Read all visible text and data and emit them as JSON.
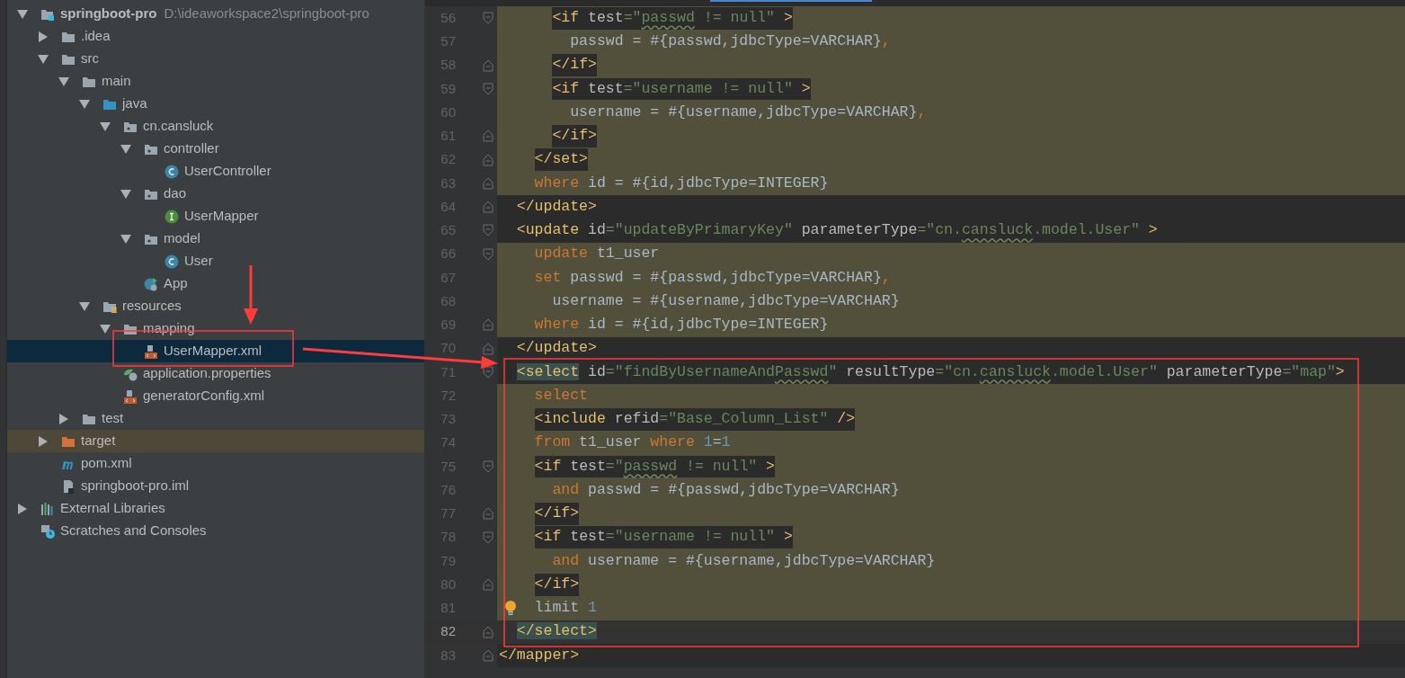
{
  "project_tree": [
    {
      "label": "springboot-pro",
      "path": "D:\\ideaworkspace2\\springboot-pro",
      "kind": "module",
      "expanded": true,
      "selected": false,
      "children": [
        {
          "label": ".idea",
          "kind": "folder",
          "expanded": false,
          "selected": false
        },
        {
          "label": "src",
          "kind": "folder",
          "expanded": true,
          "selected": false,
          "children": [
            {
              "label": "main",
              "kind": "folder",
              "expanded": true,
              "selected": false,
              "children": [
                {
                  "label": "java",
                  "kind": "source-folder",
                  "expanded": true,
                  "selected": false,
                  "children": [
                    {
                      "label": "cn.cansluck",
                      "kind": "package",
                      "expanded": true,
                      "selected": false,
                      "children": [
                        {
                          "label": "controller",
                          "kind": "package",
                          "expanded": true,
                          "selected": false,
                          "children": [
                            {
                              "label": "UserController",
                              "kind": "class",
                              "selected": false
                            }
                          ]
                        },
                        {
                          "label": "dao",
                          "kind": "package",
                          "expanded": true,
                          "selected": false,
                          "children": [
                            {
                              "label": "UserMapper",
                              "kind": "interface",
                              "selected": false
                            }
                          ]
                        },
                        {
                          "label": "model",
                          "kind": "package",
                          "expanded": true,
                          "selected": false,
                          "children": [
                            {
                              "label": "User",
                              "kind": "class",
                              "selected": false
                            }
                          ]
                        },
                        {
                          "label": "App",
                          "kind": "spring-app",
                          "selected": false
                        }
                      ]
                    }
                  ]
                },
                {
                  "label": "resources",
                  "kind": "resources-folder",
                  "expanded": true,
                  "selected": false,
                  "children": [
                    {
                      "label": "mapping",
                      "kind": "folder",
                      "expanded": true,
                      "selected": false,
                      "children": [
                        {
                          "label": "UserMapper.xml",
                          "kind": "xml",
                          "selected": true
                        }
                      ]
                    },
                    {
                      "label": "application.properties",
                      "kind": "spring-properties",
                      "selected": false
                    },
                    {
                      "label": "generatorConfig.xml",
                      "kind": "xml",
                      "selected": false
                    }
                  ]
                }
              ]
            },
            {
              "label": "test",
              "kind": "folder",
              "expanded": false,
              "selected": false
            }
          ]
        },
        {
          "label": "target",
          "kind": "excluded-folder",
          "expanded": false,
          "selected": false
        },
        {
          "label": "pom.xml",
          "kind": "maven",
          "selected": false
        },
        {
          "label": "springboot-pro.iml",
          "kind": "iml",
          "selected": false
        }
      ]
    },
    {
      "label": "External Libraries",
      "kind": "libraries",
      "expanded": false,
      "selected": false
    },
    {
      "label": "Scratches and Consoles",
      "kind": "scratches",
      "selected": false
    }
  ],
  "editor": {
    "lines": [
      {
        "number": "56",
        "highlighted": true,
        "tag_chip": true,
        "fold_start": true,
        "fold_end": false,
        "current": false,
        "tokens": [
          {
            "text": "      <if",
            "kind": "tag"
          },
          {
            "text": " test",
            "kind": "attr"
          },
          {
            "text": "=\"",
            "kind": "string"
          },
          {
            "text": "passwd",
            "kind": "string",
            "typo": true
          },
          {
            "text": " != null\"",
            "kind": "string"
          },
          {
            "text": " >",
            "kind": "tag"
          }
        ]
      },
      {
        "number": "57",
        "highlighted": true,
        "tag_chip": false,
        "fold_start": false,
        "fold_end": false,
        "current": false,
        "tokens": [
          {
            "text": "        passwd = #{passwd,jdbcType=VARCHAR}",
            "kind": "plain"
          },
          {
            "text": ",",
            "kind": "keyword"
          }
        ]
      },
      {
        "number": "58",
        "highlighted": true,
        "tag_chip": true,
        "fold_start": false,
        "fold_end": true,
        "current": false,
        "tokens": [
          {
            "text": "      </if>",
            "kind": "tag"
          }
        ]
      },
      {
        "number": "59",
        "highlighted": true,
        "tag_chip": true,
        "fold_start": true,
        "fold_end": false,
        "current": false,
        "tokens": [
          {
            "text": "      <if",
            "kind": "tag"
          },
          {
            "text": " test",
            "kind": "attr"
          },
          {
            "text": "=\"username != null\"",
            "kind": "string"
          },
          {
            "text": " >",
            "kind": "tag"
          }
        ]
      },
      {
        "number": "60",
        "highlighted": true,
        "tag_chip": false,
        "fold_start": false,
        "fold_end": false,
        "current": false,
        "tokens": [
          {
            "text": "        username = #{username,jdbcType=VARCHAR}",
            "kind": "plain"
          },
          {
            "text": ",",
            "kind": "keyword"
          }
        ]
      },
      {
        "number": "61",
        "highlighted": true,
        "tag_chip": true,
        "fold_start": false,
        "fold_end": true,
        "current": false,
        "tokens": [
          {
            "text": "      </if>",
            "kind": "tag"
          }
        ]
      },
      {
        "number": "62",
        "highlighted": true,
        "tag_chip": true,
        "fold_start": false,
        "fold_end": true,
        "current": false,
        "tokens": [
          {
            "text": "    </set>",
            "kind": "tag"
          }
        ]
      },
      {
        "number": "63",
        "highlighted": true,
        "tag_chip": false,
        "fold_start": false,
        "fold_end": true,
        "current": false,
        "tokens": [
          {
            "text": "    where",
            "kind": "keyword"
          },
          {
            "text": " id = #{id,jdbcType=INTEGER}",
            "kind": "plain"
          }
        ]
      },
      {
        "number": "64",
        "highlighted": false,
        "tag_chip": false,
        "fold_start": false,
        "fold_end": true,
        "current": false,
        "tokens": [
          {
            "text": "  </update>",
            "kind": "tag"
          }
        ]
      },
      {
        "number": "65",
        "highlighted": false,
        "tag_chip": false,
        "fold_start": true,
        "fold_end": false,
        "current": false,
        "tokens": [
          {
            "text": "  <update",
            "kind": "tag"
          },
          {
            "text": " id",
            "kind": "attr"
          },
          {
            "text": "=\"updateByPrimaryKey\"",
            "kind": "string"
          },
          {
            "text": " parameterType",
            "kind": "attr"
          },
          {
            "text": "=\"cn.",
            "kind": "string"
          },
          {
            "text": "cansluck",
            "kind": "string",
            "typo": true
          },
          {
            "text": ".model.User\"",
            "kind": "string"
          },
          {
            "text": " >",
            "kind": "tag"
          }
        ]
      },
      {
        "number": "66",
        "highlighted": true,
        "tag_chip": false,
        "fold_start": true,
        "fold_end": false,
        "current": false,
        "tokens": [
          {
            "text": "    update",
            "kind": "keyword"
          },
          {
            "text": " t1_user",
            "kind": "plain"
          }
        ]
      },
      {
        "number": "67",
        "highlighted": true,
        "tag_chip": false,
        "fold_start": false,
        "fold_end": false,
        "current": false,
        "tokens": [
          {
            "text": "    set",
            "kind": "keyword"
          },
          {
            "text": " passwd = #{passwd,jdbcType=VARCHAR}",
            "kind": "plain"
          },
          {
            "text": ",",
            "kind": "keyword"
          }
        ]
      },
      {
        "number": "68",
        "highlighted": true,
        "tag_chip": false,
        "fold_start": false,
        "fold_end": false,
        "current": false,
        "tokens": [
          {
            "text": "      username = #{username,jdbcType=VARCHAR}",
            "kind": "plain"
          }
        ]
      },
      {
        "number": "69",
        "highlighted": true,
        "tag_chip": false,
        "fold_start": false,
        "fold_end": true,
        "current": false,
        "tokens": [
          {
            "text": "    where",
            "kind": "keyword"
          },
          {
            "text": " id = #{id,jdbcType=INTEGER}",
            "kind": "plain"
          }
        ]
      },
      {
        "number": "70",
        "highlighted": false,
        "tag_chip": false,
        "fold_start": false,
        "fold_end": true,
        "current": false,
        "tokens": [
          {
            "text": "  </update>",
            "kind": "tag"
          }
        ]
      },
      {
        "number": "71",
        "highlighted": false,
        "tag_chip": false,
        "fold_start": true,
        "fold_end": false,
        "current": false,
        "tokens": [
          {
            "text": "  <select",
            "kind": "tag-matched"
          },
          {
            "text": " id",
            "kind": "attr"
          },
          {
            "text": "=\"findByUsernameAnd",
            "kind": "string"
          },
          {
            "text": "Passwd",
            "kind": "string",
            "typo": true
          },
          {
            "text": "\"",
            "kind": "string"
          },
          {
            "text": " resultType",
            "kind": "attr"
          },
          {
            "text": "=\"cn.",
            "kind": "string"
          },
          {
            "text": "cansluck",
            "kind": "string",
            "typo": true
          },
          {
            "text": ".model.User\"",
            "kind": "string"
          },
          {
            "text": " parameterType",
            "kind": "attr"
          },
          {
            "text": "=\"map\"",
            "kind": "string"
          },
          {
            "text": ">",
            "kind": "tag"
          }
        ]
      },
      {
        "number": "72",
        "highlighted": true,
        "tag_chip": false,
        "fold_start": false,
        "fold_end": false,
        "current": false,
        "tokens": [
          {
            "text": "    select",
            "kind": "keyword"
          }
        ]
      },
      {
        "number": "73",
        "highlighted": true,
        "tag_chip": true,
        "fold_start": false,
        "fold_end": false,
        "current": false,
        "tokens": [
          {
            "text": "    <include",
            "kind": "tag"
          },
          {
            "text": " refid",
            "kind": "attr"
          },
          {
            "text": "=\"Base_Column_List\"",
            "kind": "string"
          },
          {
            "text": " />",
            "kind": "tag"
          }
        ]
      },
      {
        "number": "74",
        "highlighted": true,
        "tag_chip": false,
        "fold_start": false,
        "fold_end": false,
        "current": false,
        "tokens": [
          {
            "text": "    from",
            "kind": "keyword"
          },
          {
            "text": " t1_user ",
            "kind": "plain"
          },
          {
            "text": "where",
            "kind": "keyword"
          },
          {
            "text": " 1",
            "kind": "number"
          },
          {
            "text": "=",
            "kind": "plain"
          },
          {
            "text": "1",
            "kind": "number"
          }
        ]
      },
      {
        "number": "75",
        "highlighted": true,
        "tag_chip": true,
        "fold_start": true,
        "fold_end": false,
        "current": false,
        "tokens": [
          {
            "text": "    <if",
            "kind": "tag"
          },
          {
            "text": " test",
            "kind": "attr"
          },
          {
            "text": "=\"",
            "kind": "string"
          },
          {
            "text": "passwd",
            "kind": "string",
            "typo": true
          },
          {
            "text": " != null\"",
            "kind": "string"
          },
          {
            "text": " >",
            "kind": "tag"
          }
        ]
      },
      {
        "number": "76",
        "highlighted": true,
        "tag_chip": false,
        "fold_start": false,
        "fold_end": false,
        "current": false,
        "tokens": [
          {
            "text": "      and",
            "kind": "keyword"
          },
          {
            "text": " passwd = #{passwd,jdbcType=VARCHAR}",
            "kind": "plain"
          }
        ]
      },
      {
        "number": "77",
        "highlighted": true,
        "tag_chip": true,
        "fold_start": false,
        "fold_end": true,
        "current": false,
        "tokens": [
          {
            "text": "    </if>",
            "kind": "tag"
          }
        ]
      },
      {
        "number": "78",
        "highlighted": true,
        "tag_chip": true,
        "fold_start": true,
        "fold_end": false,
        "current": false,
        "tokens": [
          {
            "text": "    <if",
            "kind": "tag"
          },
          {
            "text": " test",
            "kind": "attr"
          },
          {
            "text": "=\"username != null\"",
            "kind": "string"
          },
          {
            "text": " >",
            "kind": "tag"
          }
        ]
      },
      {
        "number": "79",
        "highlighted": true,
        "tag_chip": false,
        "fold_start": false,
        "fold_end": false,
        "current": false,
        "tokens": [
          {
            "text": "      and",
            "kind": "keyword"
          },
          {
            "text": " username = #{username,jdbcType=VARCHAR}",
            "kind": "plain"
          }
        ]
      },
      {
        "number": "80",
        "highlighted": true,
        "tag_chip": true,
        "fold_start": false,
        "fold_end": true,
        "current": false,
        "tokens": [
          {
            "text": "    </if>",
            "kind": "tag"
          }
        ]
      },
      {
        "number": "81",
        "highlighted": true,
        "tag_chip": false,
        "fold_start": false,
        "fold_end": false,
        "current": false,
        "bulb": true,
        "tokens": [
          {
            "text": "    limit",
            "kind": "plain"
          },
          {
            "text": " 1",
            "kind": "number"
          }
        ]
      },
      {
        "number": "82",
        "highlighted": false,
        "tag_chip": false,
        "fold_start": false,
        "fold_end": true,
        "current": true,
        "tokens": [
          {
            "text": "  </select>",
            "kind": "tag-matched"
          }
        ]
      },
      {
        "number": "83",
        "highlighted": false,
        "tag_chip": false,
        "fold_start": false,
        "fold_end": true,
        "current": false,
        "tokens": [
          {
            "text": "</mapper>",
            "kind": "tag"
          }
        ]
      }
    ]
  }
}
